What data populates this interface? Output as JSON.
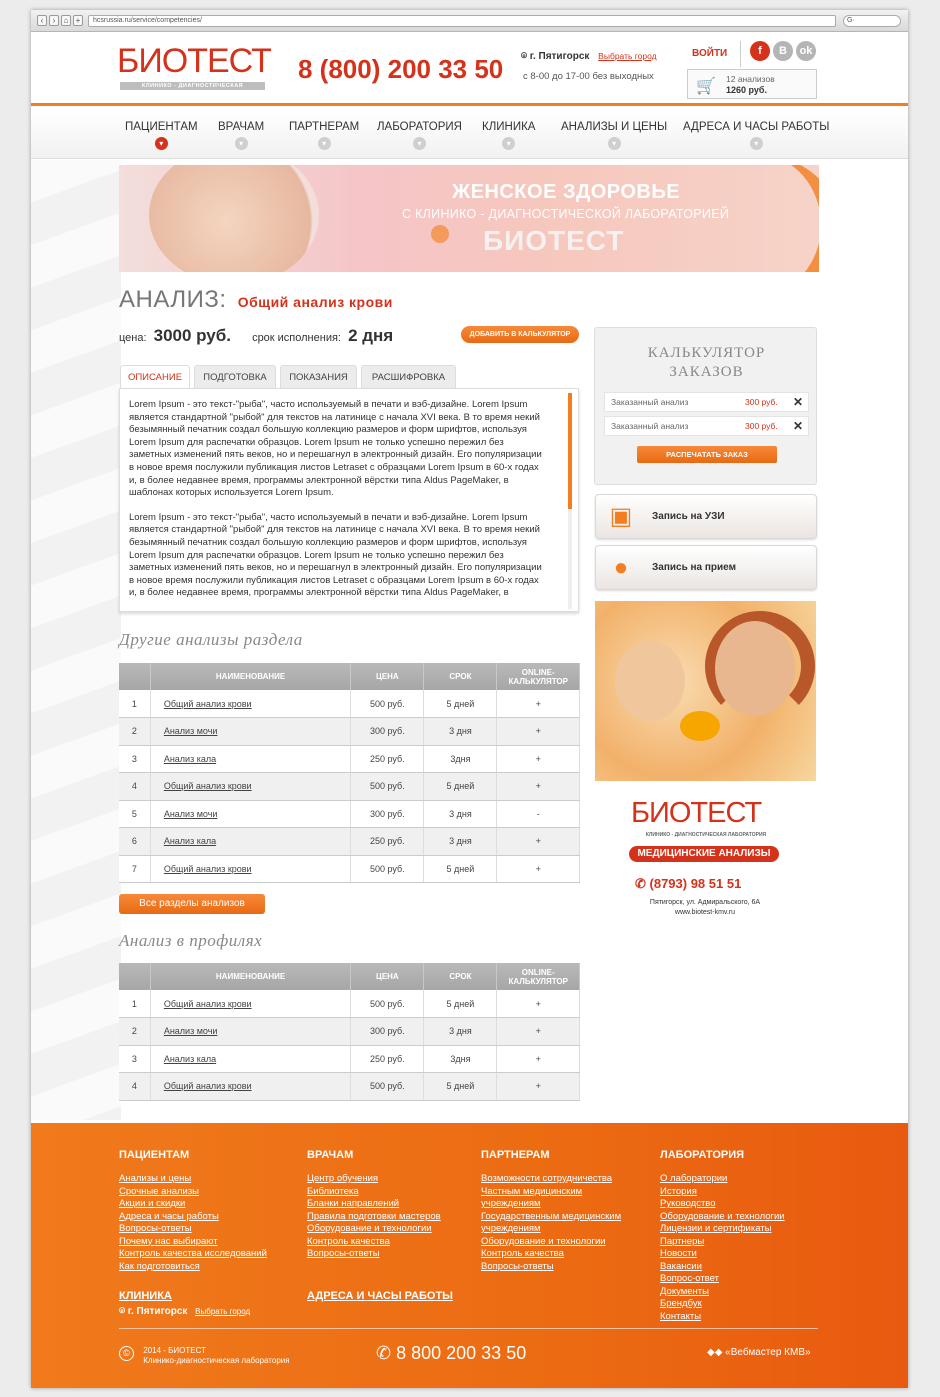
{
  "browser": {
    "url": "hcsrussia.ru/service/competencies/"
  },
  "header": {
    "logo_text": "БИОТЕСТ",
    "logo_sub": "КЛИНИКО - ДИАГНОСТИЧЕСКАЯ ЛАБОРАТОРИЯ",
    "phone": "8 (800) 200 33 50",
    "city": "г. Пятигорск",
    "choose_city": "Выбрать город",
    "hours": "с 8-00 до 17-00 без выходных",
    "login": "ВОЙТИ",
    "cart_count": "12 анализов",
    "cart_sum": "1260 руб.",
    "brand_color": "#d4321a",
    "accent_color": "#f47d20"
  },
  "nav": [
    {
      "label": "ПАЦИЕНТАМ"
    },
    {
      "label": "ВРАЧАМ"
    },
    {
      "label": "ПАРТНЕРАМ"
    },
    {
      "label": "ЛАБОРАТОРИЯ"
    },
    {
      "label": "КЛИНИКА"
    },
    {
      "label": "АНАЛИЗЫ И ЦЕНЫ"
    },
    {
      "label": "АДРЕСА И ЧАСЫ РАБОТЫ"
    }
  ],
  "banner": {
    "line1": "ЖЕНСКОЕ ЗДОРОВЬЕ",
    "line2": "С КЛИНИКО - ДИАГНОСТИЧЕСКОЙ ЛАБОРАТОРИЕЙ",
    "line3": "БИОТЕСТ"
  },
  "analysis": {
    "heading": "АНАЛИЗ:",
    "name": "Общий анализ крови",
    "price_label": "цена:",
    "price": "3000 руб.",
    "term_label": "срок исполнения:",
    "term": "2 дня",
    "add_button": "ДОБАВИТЬ В КАЛЬКУЛЯТОР"
  },
  "tabs": [
    {
      "label": "ОПИСАНИЕ"
    },
    {
      "label": "ПОДГОТОВКА"
    },
    {
      "label": "ПОКАЗАНИЯ"
    },
    {
      "label": "РАСШИФРОВКА"
    }
  ],
  "description": [
    "Lorem Ipsum - это текст-\"рыба\", часто используемый в печати и вэб-дизайне. Lorem Ipsum является стандартной \"рыбой\" для текстов на латинице с начала XVI века. В то время некий безымянный печатник создал большую коллекцию размеров и форм шрифтов, используя Lorem Ipsum для распечатки образцов. Lorem Ipsum не только успешно пережил без заметных изменений пять веков, но и перешагнул в электронный дизайн. Его популяризации в новое время послужили публикация листов Letraset с образцами Lorem Ipsum в 60-х годах и, в более недавнее время, программы электронной вёрстки типа Aldus PageMaker, в шаблонах которых используется Lorem Ipsum.",
    "Lorem Ipsum - это текст-\"рыба\", часто используемый в печати и вэб-дизайне. Lorem Ipsum является стандартной \"рыбой\" для текстов на латинице с начала XVI века. В то время некий безымянный печатник создал большую коллекцию размеров и форм шрифтов, используя Lorem Ipsum для распечатки образцов. Lorem Ipsum не только успешно пережил без заметных изменений пять веков, но и перешагнул в электронный дизайн. Его популяризации в новое время послужили публикация листов Letraset с образцами Lorem Ipsum в 60-х годах и, в более недавнее время, программы электронной вёрстки типа Aldus PageMaker, в"
  ],
  "other": {
    "title": "Другие анализы раздела",
    "columns": [
      "НАИМЕНОВАНИЕ",
      "ЦЕНА",
      "СРОК",
      "ONLINE-КАЛЬКУЛЯТОР"
    ],
    "rows": [
      [
        "1",
        "Общий анализ крови",
        "500 руб.",
        "5 дней",
        "+"
      ],
      [
        "2",
        "Анализ мочи",
        "300 руб.",
        "3 дня",
        "+"
      ],
      [
        "3",
        "Анализ кала",
        "250 руб.",
        "3дня",
        "+"
      ],
      [
        "4",
        "Общий анализ крови",
        "500 руб.",
        "5 дней",
        "+"
      ],
      [
        "5",
        "Анализ мочи",
        "300 руб.",
        "3 дня",
        "-"
      ],
      [
        "6",
        "Анализ кала",
        "250 руб.",
        "3 дня",
        "+"
      ],
      [
        "7",
        "Общий анализ крови",
        "500 руб.",
        "5 дней",
        "+"
      ]
    ],
    "all_button": "Все разделы анализов"
  },
  "profiles": {
    "title": "Анализ в профилях",
    "columns": [
      "НАИМЕНОВАНИЕ",
      "ЦЕНА",
      "СРОК",
      "ONLINE-КАЛЬКУЛЯТОР"
    ],
    "rows": [
      [
        "1",
        "Общий анализ крови",
        "500 руб.",
        "5 дней",
        "+"
      ],
      [
        "2",
        "Анализ мочи",
        "300 руб.",
        "3 дня",
        "+"
      ],
      [
        "3",
        "Анализ кала",
        "250 руб.",
        "3дня",
        "+"
      ],
      [
        "4",
        "Общий анализ крови",
        "500 руб.",
        "5 дней",
        "+"
      ]
    ]
  },
  "calculator": {
    "title1": "КАЛЬКУЛЯТОР",
    "title2": "ЗАКАЗОВ",
    "items": [
      {
        "name": "Заказанный анализ",
        "price": "300 руб."
      },
      {
        "name": "Заказанный анализ",
        "price": "300 руб."
      }
    ],
    "print": "РАСПЕЧАТАТЬ ЗАКАЗ"
  },
  "sidebar_buttons": {
    "uzi": "Запись на УЗИ",
    "visit": "Запись на прием"
  },
  "ad": {
    "logo": "БИОТЕСТ",
    "sub": "КЛИНИКО - ДИАГНОСТИЧЕСКАЯ ЛАБОРАТОРИЯ",
    "badge": "МЕДИЦИНСКИЕ АНАЛИЗЫ",
    "phone": "(8793) 98 51 51",
    "address": "Пятигорск, ул. Адмиральского, 6А",
    "site": "www.biotest-kmv.ru"
  },
  "footer": {
    "col1": {
      "title": "ПАЦИЕНТАМ",
      "links": [
        "Анализы и цены",
        "Срочные анализы",
        "Акции и скидки",
        "Адреса и часы работы",
        "Вопросы-ответы",
        "Почему нас выбирают",
        "Контроль качества исследований",
        "Как подготовиться"
      ]
    },
    "col2": {
      "title": "ВРАЧАМ",
      "links": [
        "Центр обучения",
        "Библиотека",
        "Бланки направлений",
        "Правила подготовки мастеров",
        "Оборудование и технологии",
        "Контроль качества",
        "Вопросы-ответы"
      ]
    },
    "col3": {
      "title": "ПАРТНЕРАМ",
      "links": [
        "Возможности сотрудничества",
        "Частным медицинским",
        "учреждениям",
        "Государственным медицинским",
        "учреждениям",
        "Оборудование и технологии",
        "Контроль качества",
        "Вопросы-ответы"
      ]
    },
    "col4": {
      "title": "ЛАБОРАТОРИЯ",
      "links": [
        "О лаборатории",
        "История",
        "Руководство",
        "Оборудование и технологии",
        "Лицензии и сертификаты",
        "Партнеры",
        "Новости",
        "Вакансии",
        "Вопрос-ответ",
        "Документы",
        "Брендбук",
        "Контакты"
      ]
    },
    "clinic": "КЛИНИКА",
    "addresses": "АДРЕСА И ЧАСЫ РАБОТЫ",
    "city": "г. Пятигорск",
    "choose_city": "Выбрать город",
    "copy1": "2014 - БИОТЕСТ",
    "copy2": "Клинико-диагностическая лаборатория",
    "phone": "8 800 200 33 50",
    "dev": "«Вебмастер КМВ»"
  }
}
